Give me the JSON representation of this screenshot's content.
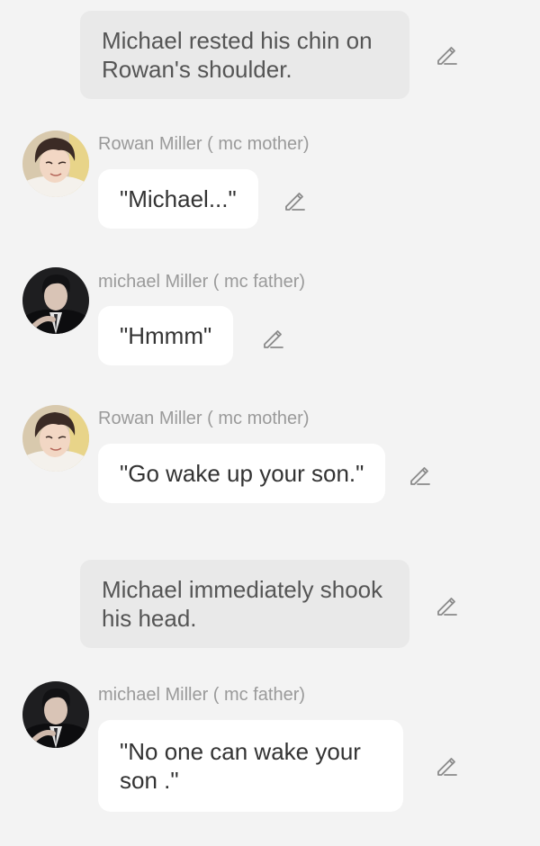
{
  "colors": {
    "background": "#f3f3f3",
    "narration_bg": "#e9e9e9",
    "bubble_bg": "#ffffff",
    "speaker_name": "#9a9a9a",
    "message_text": "#333333",
    "narration_text": "#555555",
    "edit_icon": "#8a8a8a"
  },
  "chat": {
    "messages": [
      {
        "type": "narration",
        "text": "Michael rested his chin on Rowan's shoulder.",
        "icon": "pencil-icon"
      },
      {
        "type": "dialogue",
        "speaker": "Rowan Miller ( mc mother)",
        "text": "\"Michael...\"",
        "avatar": "rowan-avatar",
        "icon": "pencil-icon"
      },
      {
        "type": "dialogue",
        "speaker": "michael Miller ( mc father)",
        "text": "\"Hmmm\"",
        "avatar": "michael-avatar",
        "icon": "pencil-icon"
      },
      {
        "type": "dialogue",
        "speaker": "Rowan Miller ( mc mother)",
        "text": "\"Go wake up your son.\"",
        "avatar": "rowan-avatar",
        "icon": "pencil-icon"
      },
      {
        "type": "narration",
        "text": "Michael immediately shook his head.",
        "icon": "pencil-icon"
      },
      {
        "type": "dialogue",
        "speaker": "michael Miller ( mc father)",
        "text": "\"No one can wake your\nson .\"",
        "avatar": "michael-avatar",
        "icon": "pencil-icon"
      }
    ]
  }
}
